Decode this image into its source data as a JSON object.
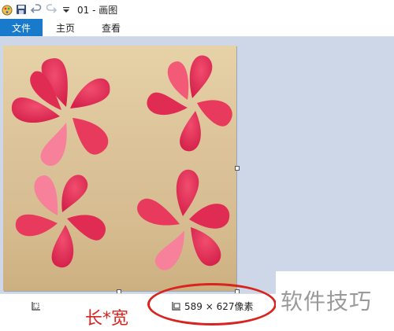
{
  "title_bar": {
    "title": "01 - 画图",
    "icons": [
      "paint-app-icon",
      "save-icon",
      "undo-icon",
      "redo-icon",
      "customize-dropdown-icon"
    ]
  },
  "ribbon": {
    "tabs": [
      {
        "label": "文件",
        "active": true
      },
      {
        "label": "主页",
        "active": false
      },
      {
        "label": "查看",
        "active": false
      }
    ],
    "accent_color": "#1979ca"
  },
  "status_bar": {
    "image_size": "589 × 627像素",
    "annotation": "长*宽",
    "annotation_color": "#d8231f"
  },
  "watermark": {
    "text": "软件技巧"
  }
}
